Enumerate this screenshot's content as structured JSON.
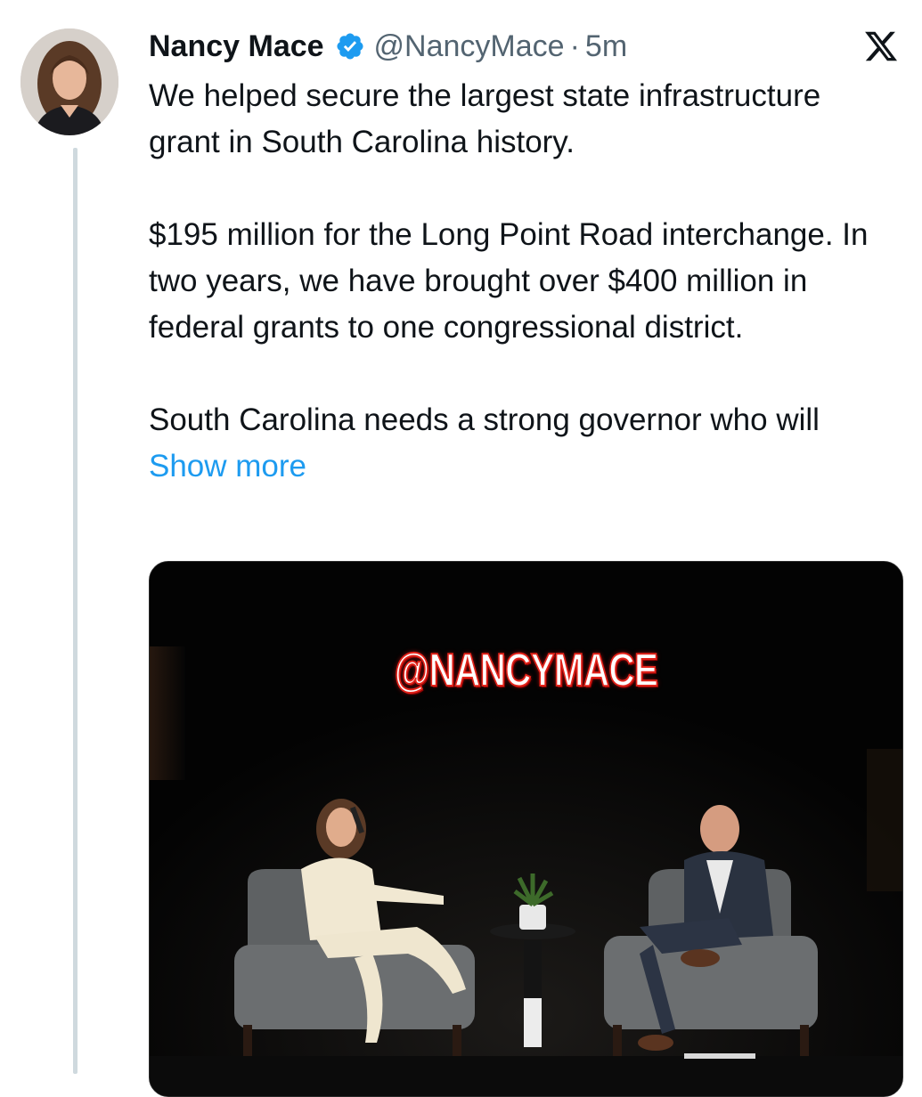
{
  "tweet": {
    "author_name": "Nancy Mace",
    "handle": "@NancyMace",
    "separator": "·",
    "time": "5m",
    "verified": true,
    "paragraphs": [
      "We helped secure the largest state infrastructure grant in South Carolina history.",
      "$195 million for the Long Point Road interchange. In two years, we have brought over $400 million in federal grants to one congressional district.",
      "South Carolina needs a strong governor who will"
    ],
    "show_more_label": "Show more"
  },
  "media": {
    "watermark_text": "@NANCYMACE"
  },
  "colors": {
    "link": "#1d9bf0",
    "verified": "#1d9bf0",
    "secondary_text": "#536471",
    "thread_line": "#cfd9de"
  },
  "icons": {
    "verified": "verified-badge-icon",
    "platform": "x-logo-icon"
  }
}
